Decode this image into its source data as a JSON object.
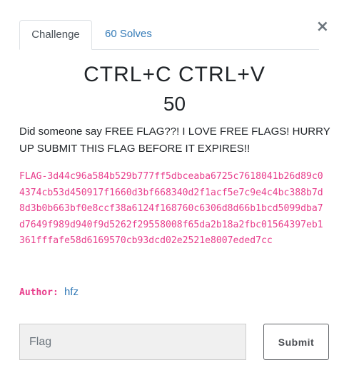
{
  "tabs": [
    {
      "label": "Challenge",
      "active": true
    },
    {
      "label": "60 Solves",
      "active": false
    }
  ],
  "close_symbol": "×",
  "challenge": {
    "name": "CTRL+C CTRL+V",
    "value": "50",
    "description": "Did someone say FREE FLAG??! I LOVE FREE FLAGS! HURRY UP SUBMIT THIS FLAG BEFORE IT EXPIRES!!",
    "flag_text": "FLAG-3d44c96a584b529b777ff5dbceaba6725c7618041b26d89c04374cb53d450917f1660d3bf668340d2f1acf5e7c9e4c4bc388b7d8d3b0b663bf0e8ccf38a6124f168760c6306d8d66b1bcd5099dba7d7649f989d940f9d5262f29558008f65da2b18a2fbc01564397eb1361fffafe58d6169570cb93dcd02e2521e8007eded7cc",
    "author_label": "Author:",
    "author_name": "hfz"
  },
  "form": {
    "input_placeholder": "Flag",
    "input_value": "",
    "submit_label": "Submit"
  },
  "colors": {
    "link": "#337ab7",
    "code": "#e83e8c",
    "input_bg": "#f0f0f0"
  }
}
